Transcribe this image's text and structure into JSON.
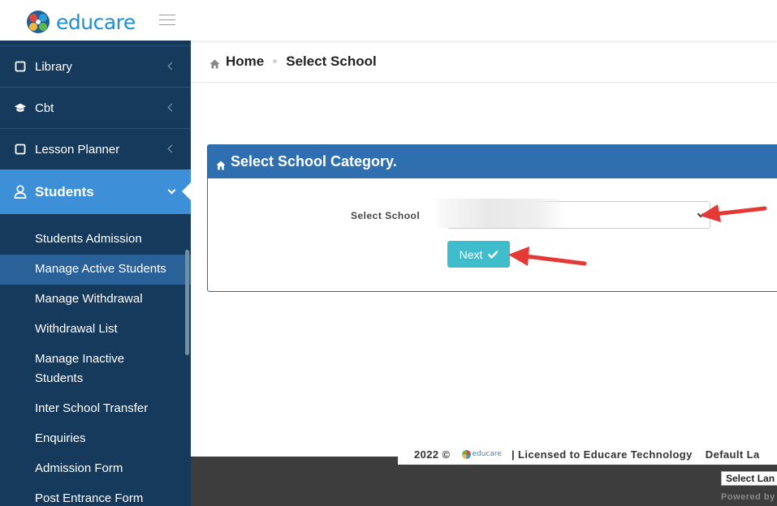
{
  "brand": {
    "name": "educare"
  },
  "sidebar": {
    "items": [
      {
        "label": "Library",
        "icon": "book-icon"
      },
      {
        "label": "Cbt",
        "icon": "graduation-cap-icon"
      },
      {
        "label": "Lesson Planner",
        "icon": "book-icon"
      }
    ],
    "active": {
      "label": "Students",
      "icon": "user-icon"
    },
    "subitems": [
      "Students Admission",
      "Manage Active Students",
      "Manage Withdrawal",
      "Withdrawal List",
      "Manage Inactive Students",
      "Inter School Transfer",
      "Enquiries",
      "Admission Form",
      "Post Entrance Form"
    ],
    "highlighted_subitem": "Manage Active Students"
  },
  "breadcrumb": {
    "home": "Home",
    "current": "Select School"
  },
  "panel": {
    "title": "Select School Category.",
    "select_label": "Select School",
    "select_value": "",
    "next_label": "Next"
  },
  "footer": {
    "year": "2022 ©",
    "logo_text": "educare",
    "license": "|  Licensed to Educare Technology",
    "default_lang": "Default La",
    "lang_select": "Select Lan",
    "powered": "Powered by"
  },
  "colors": {
    "sidebar_bg": "#163a5c",
    "active_nav": "#3d8fd8",
    "panel_header": "#2f6fb0",
    "next_button": "#3fbdcc",
    "annotation_arrow": "#e53935"
  }
}
